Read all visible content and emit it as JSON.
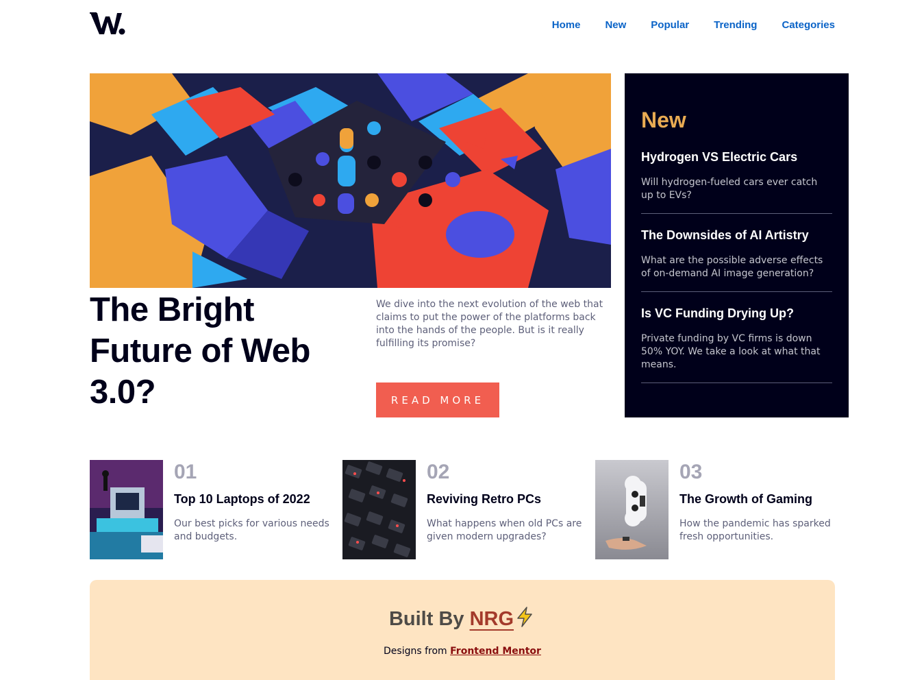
{
  "header": {
    "logo_alt": "W.",
    "nav": [
      {
        "label": "Home"
      },
      {
        "label": "New"
      },
      {
        "label": "Popular"
      },
      {
        "label": "Trending"
      },
      {
        "label": "Categories"
      }
    ]
  },
  "hero": {
    "image_icon": "web3-abstract-blocks-image",
    "title": "The Bright Future of Web 3.0?",
    "description": "We dive into the next evolution of the web that claims to put the power of the platforms back into the hands of the people. But is it really fulfilling its promise?",
    "cta_label": "READ MORE"
  },
  "new_panel": {
    "title": "New",
    "items": [
      {
        "title": "Hydrogen VS Electric Cars",
        "description": "Will hydrogen-fueled cars ever catch up to EVs?"
      },
      {
        "title": "The Downsides of AI Artistry",
        "description": "What are the possible adverse effects of on-demand AI image generation?"
      },
      {
        "title": "Is VC Funding Drying Up?",
        "description": "Private funding by VC firms is down 50% YOY. We take a look at what that means."
      }
    ]
  },
  "cards": [
    {
      "number": "01",
      "title": "Top 10 Laptops of 2022",
      "description": "Our best picks for various needs and budgets.",
      "image_icon": "retro-pc-image"
    },
    {
      "number": "02",
      "title": "Reviving Retro PCs",
      "description": "What happens when old PCs are given modern upgrades?",
      "image_icon": "keyboard-image"
    },
    {
      "number": "03",
      "title": "The Growth of Gaming",
      "description": "How the pandemic has sparked fresh opportunities.",
      "image_icon": "gamepad-image"
    }
  ],
  "footer": {
    "built_by_prefix": "Built By",
    "built_by_link": "NRG",
    "designs_prefix": "Designs from",
    "designs_link": "Frontend Mentor"
  },
  "colors": {
    "nav_link": "#0a63c7",
    "accent_orange": "#e9ab53",
    "cta_red": "#f15e50",
    "dark_navy": "#00001a",
    "footer_bg": "#fee4c2"
  }
}
